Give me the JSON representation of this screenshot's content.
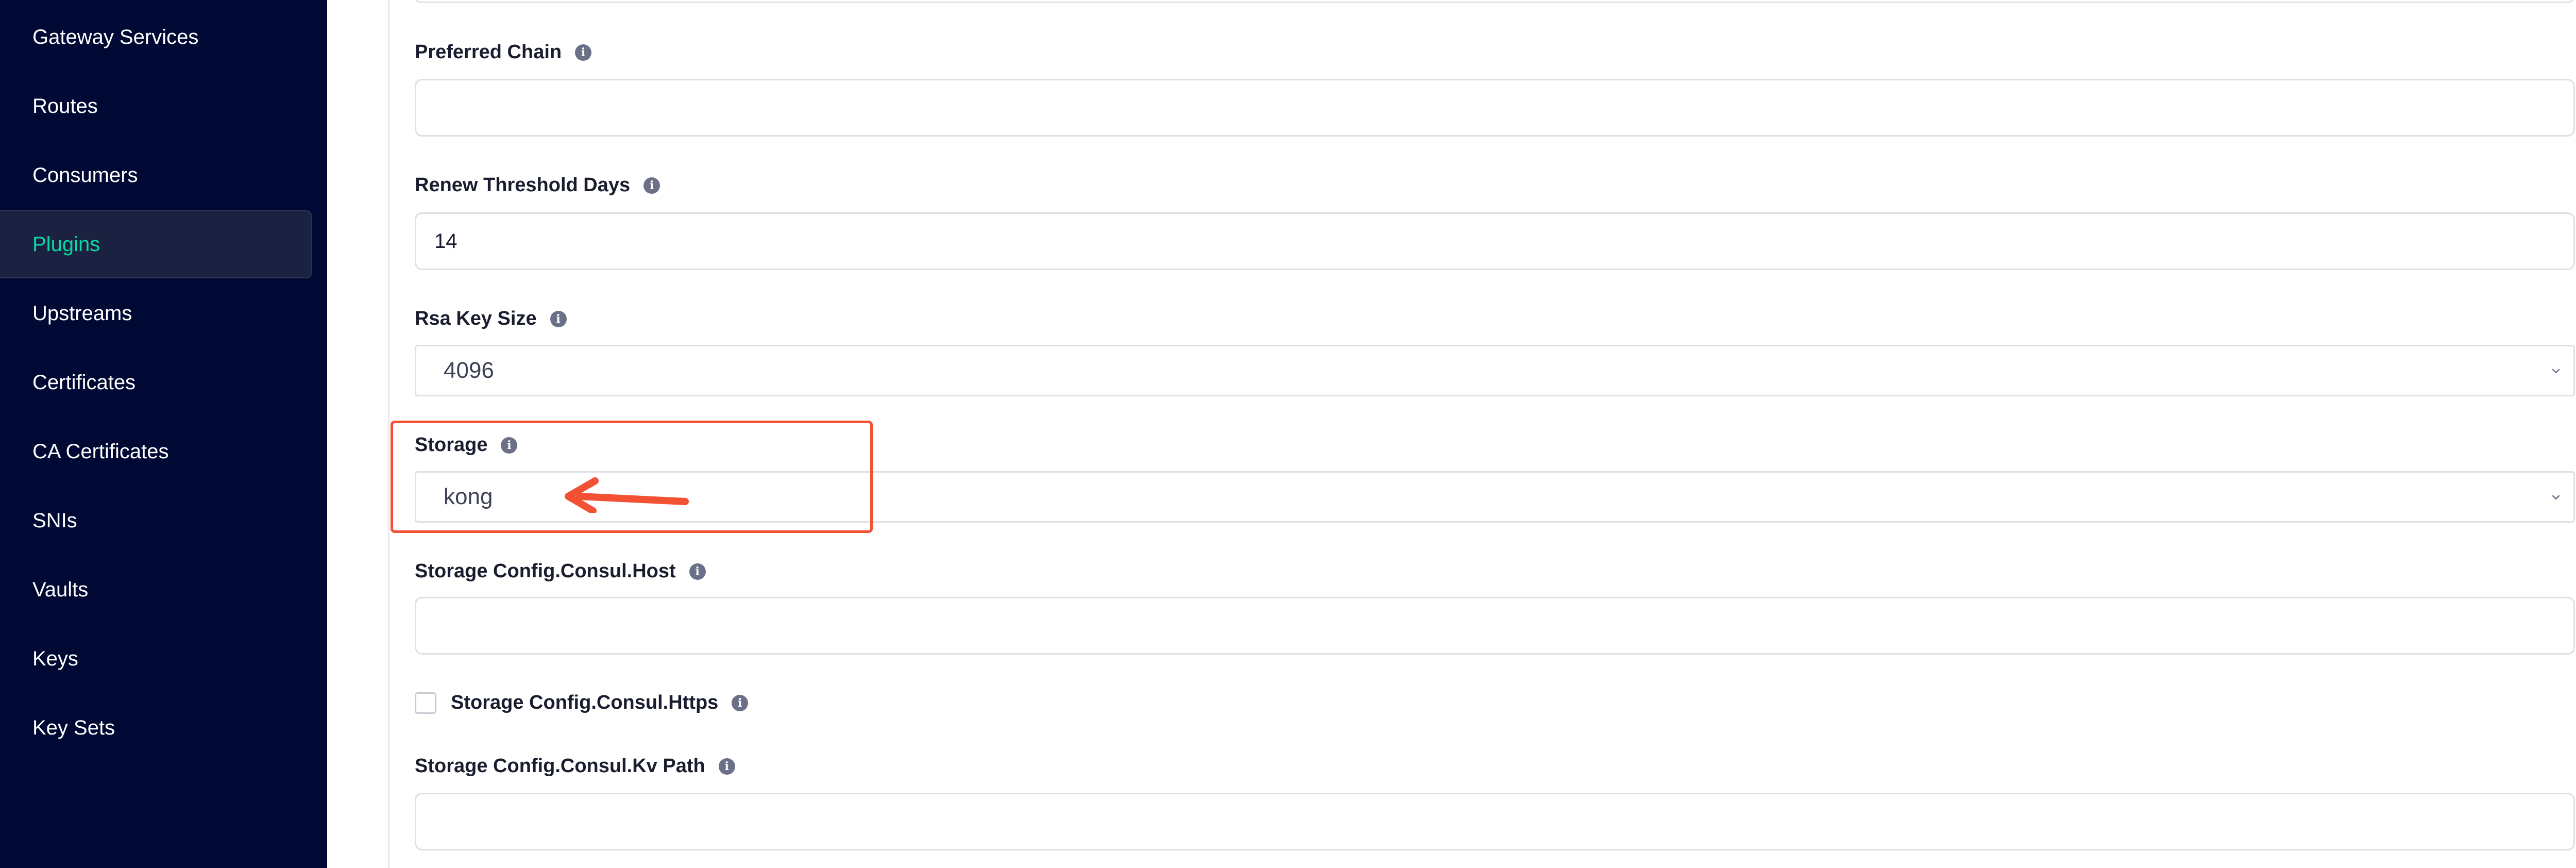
{
  "sidebar": {
    "items": [
      {
        "label": "Gateway Services"
      },
      {
        "label": "Routes"
      },
      {
        "label": "Consumers"
      },
      {
        "label": "Plugins",
        "active": true
      },
      {
        "label": "Upstreams"
      },
      {
        "label": "Certificates"
      },
      {
        "label": "CA Certificates"
      },
      {
        "label": "SNIs"
      },
      {
        "label": "Vaults"
      },
      {
        "label": "Keys"
      },
      {
        "label": "Key Sets"
      }
    ]
  },
  "form": {
    "preferred_chain": {
      "label": "Preferred Chain",
      "value": ""
    },
    "renew_threshold_days": {
      "label": "Renew Threshold Days",
      "value": "14"
    },
    "rsa_key_size": {
      "label": "Rsa Key Size",
      "value": "4096"
    },
    "storage": {
      "label": "Storage",
      "value": "kong"
    },
    "consul_host": {
      "label": "Storage Config.Consul.Host",
      "value": ""
    },
    "consul_https": {
      "label": "Storage Config.Consul.Https",
      "checked": false
    },
    "consul_kv_path": {
      "label": "Storage Config.Consul.Kv Path",
      "value": ""
    }
  },
  "icons": {
    "info": "info-icon",
    "chevron": "chevron-down-icon",
    "arrow": "arrow-left-icon"
  },
  "colors": {
    "sidebar_bg": "#000933",
    "active_item": "#07d9a6",
    "highlight": "#f25233"
  }
}
